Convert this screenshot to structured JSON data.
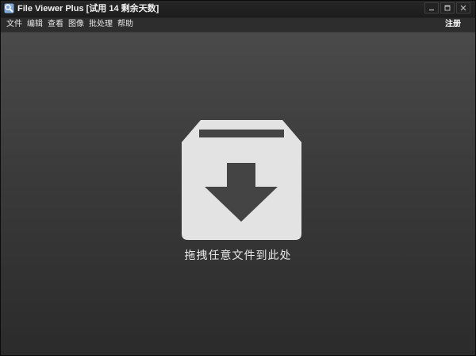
{
  "window": {
    "title": "File Viewer Plus [试用 14 剩余天数]"
  },
  "menubar": {
    "items": [
      "文件",
      "编辑",
      "查看",
      "图像",
      "批处理",
      "帮助"
    ],
    "register_label": "注册"
  },
  "drop_area": {
    "prompt": "拖拽任意文件到此处",
    "icon": "download-box-icon"
  },
  "colors": {
    "icon_fill": "#e3e3e3",
    "background_top": "#4a4a4a",
    "background_bottom": "#2b2b2b"
  }
}
